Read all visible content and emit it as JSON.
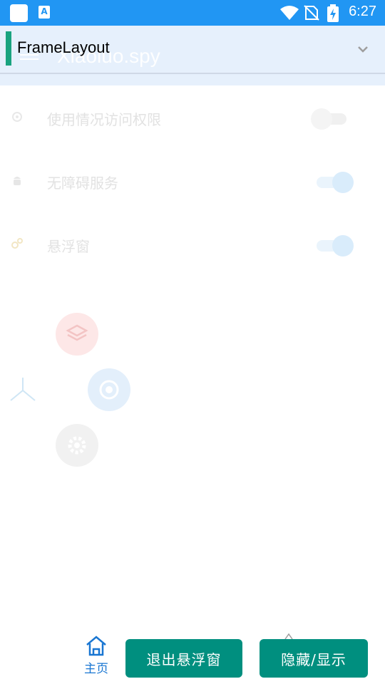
{
  "status_bar": {
    "time": "6:27",
    "notification_letter": "A"
  },
  "app": {
    "title": "Xiaoluo.spy",
    "settings": [
      {
        "label": "使用情况访问权限",
        "enabled": false,
        "icon": "gear-icon"
      },
      {
        "label": "无障碍服务",
        "enabled": true,
        "icon": "android-icon"
      },
      {
        "label": "悬浮窗",
        "enabled": true,
        "icon": "gears-icon"
      }
    ]
  },
  "overlay": {
    "layout_name": "FrameLayout"
  },
  "bottom": {
    "home_label": "主页",
    "exit_button": "退出悬浮窗",
    "toggle_button": "隐藏/显示"
  },
  "colors": {
    "status_bar": "#2196F3",
    "accent_green": "#19A37F",
    "button_teal": "#008F7F",
    "home_blue": "#1976D2"
  }
}
